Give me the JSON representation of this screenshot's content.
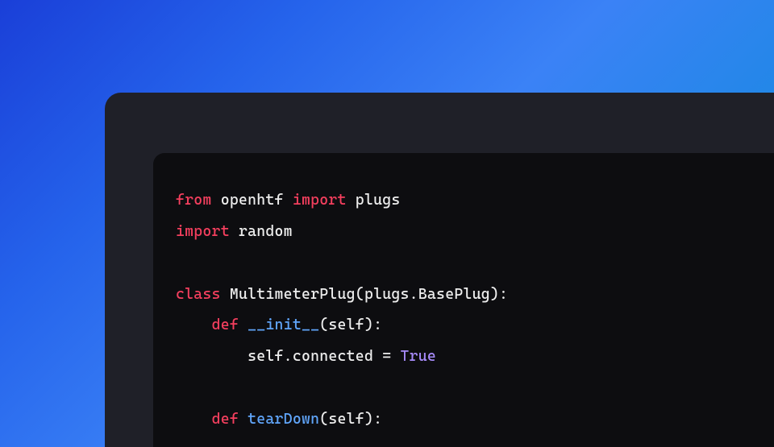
{
  "code": {
    "line1": {
      "kw_from": "from",
      "mod_openhtf": " openhtf ",
      "kw_import": "import",
      "name_plugs": " plugs"
    },
    "line2": {
      "kw_import": "import",
      "mod_random": " random"
    },
    "line3": {
      "kw_class": "class",
      "name_class": " MultimeterPlug(plugs.BasePlug):"
    },
    "line4": {
      "indent": "    ",
      "kw_def": "def",
      "space": " ",
      "fn_init": "__init__",
      "params": "(self):"
    },
    "line5": {
      "indent": "        ",
      "body_a": "self.connected = ",
      "val_true": "True"
    },
    "line6": {
      "indent": "    ",
      "kw_def": "def",
      "space": " ",
      "fn_teardown": "tearDown",
      "params": "(self):"
    }
  },
  "colors": {
    "keyword": "#f43f5e",
    "function": "#60a5fa",
    "constant": "#a78bfa",
    "text": "#ededed",
    "panel_bg": "#0d0d10",
    "window_bg": "#1f2028"
  }
}
